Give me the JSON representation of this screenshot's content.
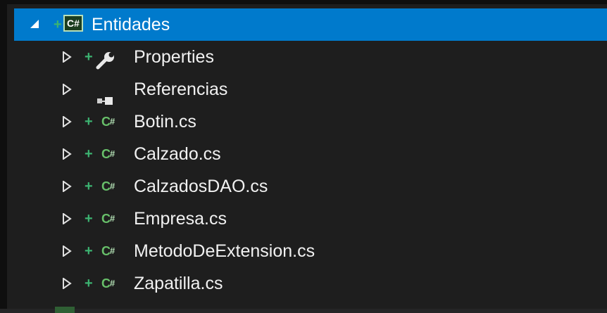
{
  "tree": {
    "project": {
      "label": "Entidades",
      "icon": "csharp-project-icon",
      "badge": "C#",
      "expanded": true
    },
    "items": [
      {
        "label": "Properties",
        "icon": "wrench-icon",
        "plus": true
      },
      {
        "label": "Referencias",
        "icon": "references-icon",
        "plus": false
      },
      {
        "label": "Botin.cs",
        "icon": "csharp-file-icon",
        "plus": true
      },
      {
        "label": "Calzado.cs",
        "icon": "csharp-file-icon",
        "plus": true
      },
      {
        "label": "CalzadosDAO.cs",
        "icon": "csharp-file-icon",
        "plus": true
      },
      {
        "label": "Empresa.cs",
        "icon": "csharp-file-icon",
        "plus": true
      },
      {
        "label": "MetodoDeExtension.cs",
        "icon": "csharp-file-icon",
        "plus": true
      },
      {
        "label": "Zapatilla.cs",
        "icon": "csharp-file-icon",
        "plus": true
      }
    ],
    "plus_glyph": "+",
    "cs_letter": "C",
    "cs_hash": "#"
  },
  "colors": {
    "selection": "#007acc",
    "background": "#1e1e1e",
    "plus": "#3cb371",
    "csharp": "#68c06a"
  }
}
